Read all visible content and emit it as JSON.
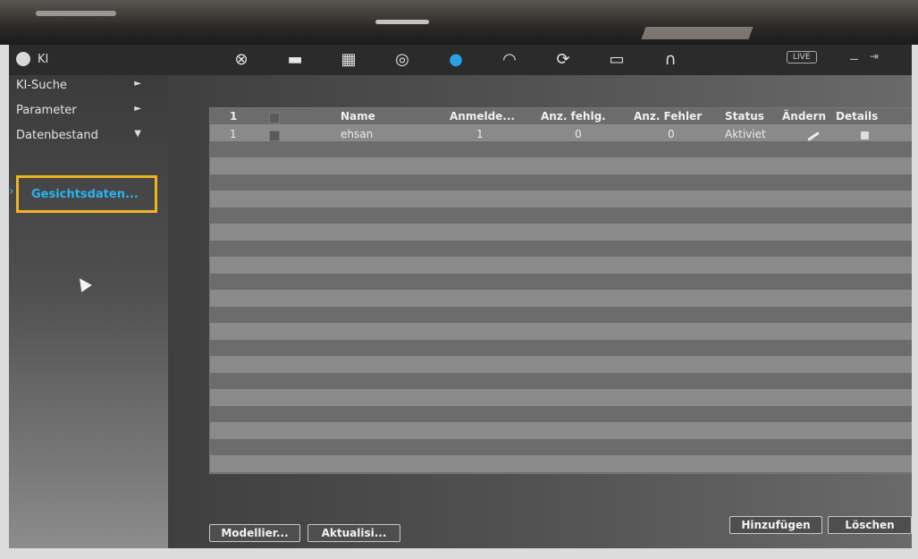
{
  "app": {
    "title": "KI"
  },
  "toolbar": {
    "icons": [
      "film-reel-icon",
      "camera-dome-icon",
      "files-icon",
      "globe-icon",
      "ai-active-icon",
      "speedometer-icon",
      "refresh-icon",
      "monitor-icon",
      "headset-icon"
    ],
    "live_label": "LIVE",
    "accent": "#2aa0e6"
  },
  "sidebar": {
    "items": [
      {
        "label": "KI-Suche",
        "arrow": "►"
      },
      {
        "label": "Parameter",
        "arrow": "►"
      },
      {
        "label": "Datenbestand",
        "arrow": "▼"
      }
    ],
    "sub_item": "Gesichtsdaten...",
    "highlight_color": "#f0b422"
  },
  "table": {
    "header": {
      "idx": "1",
      "name": "Name",
      "anmelde": "Anmelde...",
      "fehlg": "Anz. fehlg.",
      "fehler": "Anz. Fehler",
      "status": "Status",
      "aendern": "Ändern",
      "details": "Details"
    },
    "rows": [
      {
        "idx": "1",
        "name": "ehsan",
        "anmelde": "1",
        "fehlg": "0",
        "fehler": "0",
        "status": "Aktiviet"
      }
    ]
  },
  "buttons": {
    "model": "Modellier...",
    "refresh": "Aktualisi...",
    "add": "Hinzufügen",
    "delete": "Löschen"
  }
}
